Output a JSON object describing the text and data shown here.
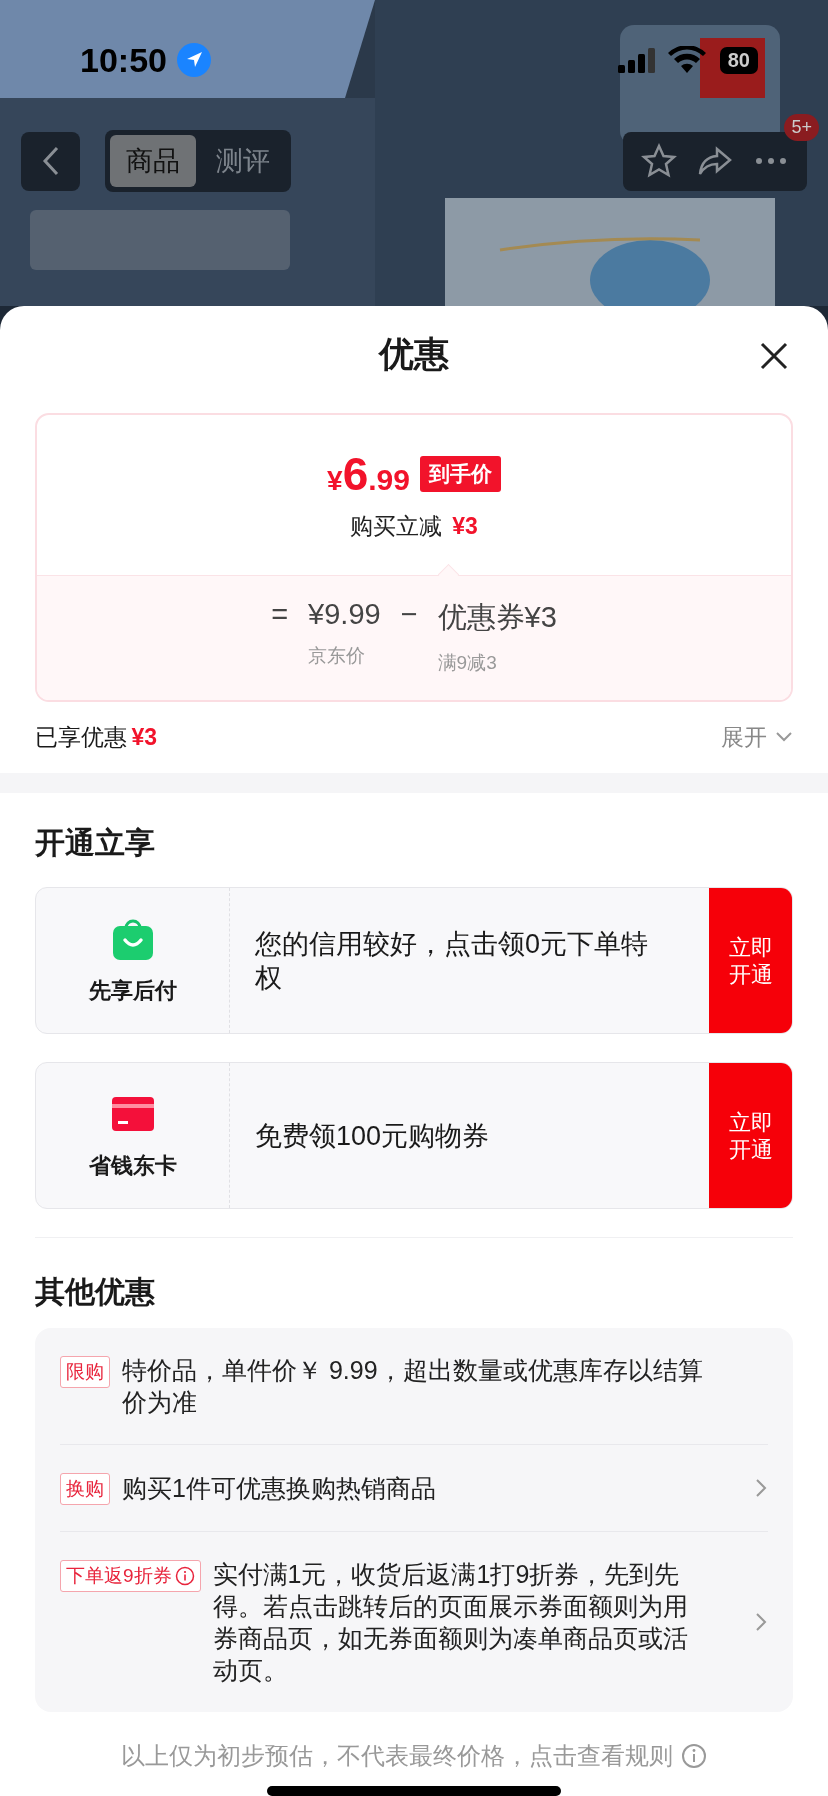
{
  "status_bar": {
    "time": "10:50",
    "battery": "80"
  },
  "nav": {
    "tabs": [
      {
        "label": "商品",
        "selected": true
      },
      {
        "label": "测评",
        "selected": false
      }
    ],
    "badge": "5+"
  },
  "sheet": {
    "title": "优惠",
    "price_card": {
      "final_price": {
        "currency": "¥",
        "integer": "6",
        "decimal": ".99"
      },
      "final_label": "到手价",
      "discount_label": "购买立减",
      "discount_value": "¥3",
      "formula": {
        "equals": "=",
        "base_price": "¥9.99",
        "minus": "−",
        "coupon": "优惠券¥3",
        "base_label": "京东价",
        "coupon_label": "满9减3"
      }
    },
    "enjoyed": {
      "label": "已享优惠",
      "value": "¥3",
      "expand": "展开"
    },
    "open_section": {
      "title": "开通立享",
      "offers": [
        {
          "kind": "bag",
          "name": "先享后付",
          "text": "您的信用较好，点击领0元下单特权",
          "button": "立即开通"
        },
        {
          "kind": "card",
          "name": "省钱东卡",
          "text": "免费领100元购物券",
          "button": "立即开通"
        }
      ]
    },
    "other_section": {
      "title": "其他优惠",
      "items": [
        {
          "kind": "note",
          "tag": "限购",
          "text": "特价品，单件价￥ 9.99，超出数量或优惠库存以结算价为准"
        },
        {
          "kind": "link",
          "tag": "换购",
          "text": "购买1件可优惠换购热销商品"
        },
        {
          "kind": "link",
          "tag": "下单返9折券",
          "tag_info": true,
          "text": "实付满1元，收货后返满1打9折券，先到先得。若点击跳转后的页面展示券面额则为用券商品页，如无券面额则为凑单商品页或活动页。"
        }
      ]
    },
    "footer": "以上仅为初步预估，不代表最终价格，点击查看规则"
  }
}
